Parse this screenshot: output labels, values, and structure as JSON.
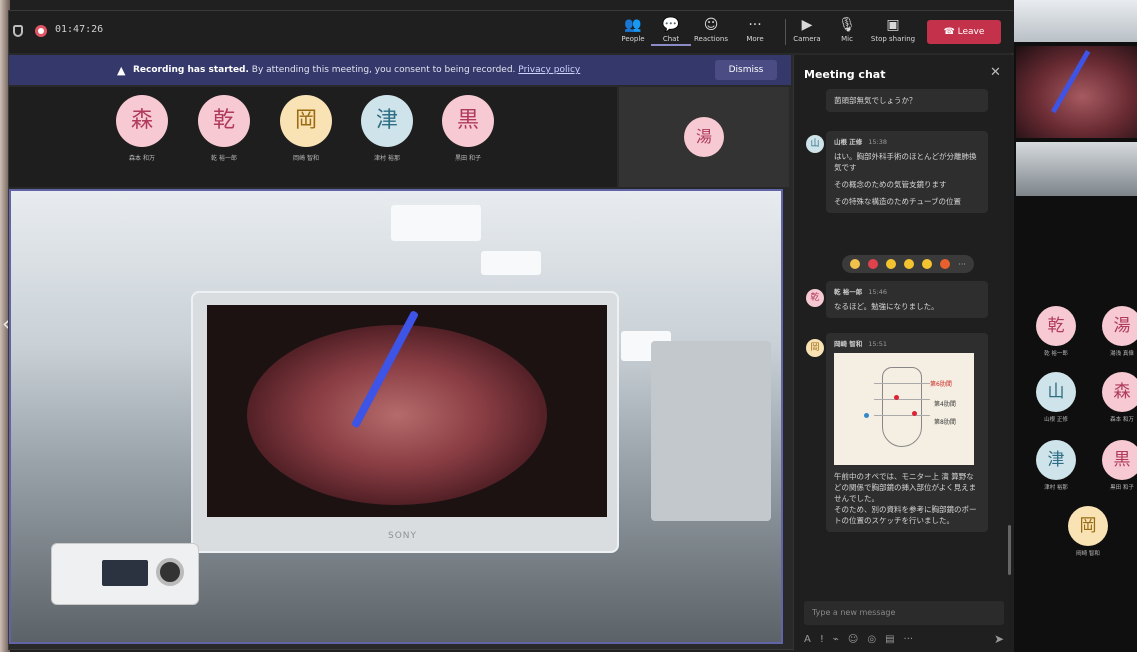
{
  "topbar": {
    "timer": "01:47:26",
    "buttons": [
      {
        "label": "People",
        "icon": "people-icon"
      },
      {
        "label": "Chat",
        "icon": "chat-icon"
      },
      {
        "label": "Reactions",
        "icon": "reactions-icon"
      },
      {
        "label": "More",
        "icon": "more-icon"
      },
      {
        "label": "Camera",
        "icon": "camera-icon"
      },
      {
        "label": "Mic",
        "icon": "mic-icon"
      },
      {
        "label": "Stop sharing",
        "icon": "share-icon"
      }
    ],
    "leave_label": "Leave"
  },
  "banner": {
    "bold": "Recording has started.",
    "text": "By attending this meeting, you consent to being recorded.",
    "link": "Privacy policy",
    "dismiss": "Dismiss"
  },
  "participants": [
    {
      "initial": "森",
      "name": "森本 和万",
      "bg": "#f6c9d3",
      "fg": "#b03a5a"
    },
    {
      "initial": "乾",
      "name": "乾 裕一郎",
      "bg": "#f6c9d3",
      "fg": "#b03a5a"
    },
    {
      "initial": "岡",
      "name": "岡崎 智和",
      "bg": "#f9e2b4",
      "fg": "#9a6b12"
    },
    {
      "initial": "津",
      "name": "津村 裕那",
      "bg": "#cfe3ea",
      "fg": "#2f6f85"
    },
    {
      "initial": "黒",
      "name": "黒田 和子",
      "bg": "#f6c9d3",
      "fg": "#b03a5a"
    }
  ],
  "side_tile": {
    "initial": "湯",
    "bg": "#f6c9d3",
    "fg": "#b03a5a"
  },
  "video": {
    "brand": "SONY"
  },
  "chat": {
    "title": "Meeting chat",
    "messages": [
      {
        "text": "菌頭部無気でしょうか？"
      },
      {
        "avatar": "山",
        "author": "山根 正修",
        "time": "15:38",
        "lines": [
          "はい。胸部外科手術のほとんどが分離肺換気です",
          "その概念のための気管支鏡ります",
          "その特殊な構造のためチューブの位置"
        ]
      },
      {
        "avatar": "乾",
        "author": "乾 裕一郎",
        "time": "15:46",
        "lines": [
          "なるほど。勉強になりました。"
        ]
      },
      {
        "avatar": "岡",
        "author": "岡崎 智和",
        "time": "15:51",
        "lines": [
          "午前中のオペでは、モニター上 演 算野などの関係で胸部鏡の挿入部位がよく見えませんでした。",
          "そのため、別の資料を参考に胸部鏡のポートの位置のスケッチを行いました。"
        ]
      }
    ],
    "sketch_labels": [
      "第6肋間",
      "第4肋間",
      "第8肋間"
    ],
    "compose_placeholder": "Type a new message"
  },
  "gallery": [
    {
      "initial": "乾",
      "name": "乾 裕一郎",
      "bg": "#f6c9d3",
      "fg": "#b03a5a"
    },
    {
      "initial": "湯",
      "name": "湯浅 真偉",
      "bg": "#f6c9d3",
      "fg": "#b03a5a"
    },
    {
      "initial": "山",
      "name": "山根 正修",
      "bg": "#cfe3ea",
      "fg": "#2f6f85"
    },
    {
      "initial": "森",
      "name": "森本 和万",
      "bg": "#f6c9d3",
      "fg": "#b03a5a"
    },
    {
      "initial": "津",
      "name": "津村 裕那",
      "bg": "#cfe3ea",
      "fg": "#2f6f85"
    },
    {
      "initial": "黒",
      "name": "黒田 和子",
      "bg": "#f6c9d3",
      "fg": "#b03a5a"
    },
    {
      "initial": "岡",
      "name": "岡崎 智和",
      "bg": "#f9e2b4",
      "fg": "#9a6b12"
    }
  ],
  "colors": {
    "accent": "#6264a7",
    "leave": "#c4314b",
    "recording": "#e05563"
  }
}
